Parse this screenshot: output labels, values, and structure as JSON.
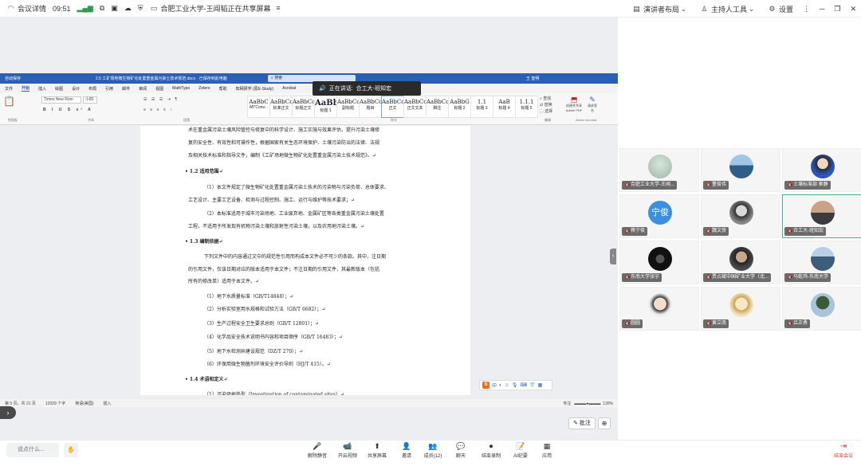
{
  "topbar": {
    "meeting_info": "会议详情",
    "time": "09:51",
    "share_title": "合肥工业大学-王闻韬正在共享屏幕",
    "presenter_layout": "演讲者布局",
    "host_tools": "主持人工具",
    "settings": "设置"
  },
  "word": {
    "autosave": "自动保存",
    "filename": "2.5 工矿场地微生物矿化处置重金属污染土技术规范.docx · 已保存到此电脑",
    "search": "搜索",
    "user": "王 奎明",
    "menus": [
      "文件",
      "开始",
      "插入",
      "绘图",
      "设计",
      "布局",
      "引用",
      "邮件",
      "审阅",
      "视图",
      "MathType",
      "Zotero",
      "帮助",
      "知网研学 (原E-Study)",
      "Acrobat"
    ],
    "font_name": "Times New Rom",
    "font_size": "小四",
    "ribbon_groups": {
      "clipboard": "剪贴板",
      "font": "字体",
      "paragraph": "段落",
      "styles": "样式",
      "edit": "编辑",
      "acrobat": "Adobe Acrobat"
    },
    "styles": [
      {
        "preview": "AaBbC",
        "name": "MTConv..."
      },
      {
        "preview": "AaBbCcDd",
        "name": "标准正文"
      },
      {
        "preview": "AaBbCcI",
        "name": "标题正文"
      },
      {
        "preview": "AaBb",
        "name": "标题 1"
      },
      {
        "preview": "AaBbCc",
        "name": "副标题"
      },
      {
        "preview": "AaBbCcDi",
        "name": "题目"
      },
      {
        "preview": "AaBbCcDi",
        "name": "正文"
      },
      {
        "preview": "AaBbCcI",
        "name": "正文文本"
      },
      {
        "preview": "AaBbCcDi",
        "name": "脚注"
      },
      {
        "preview": "AaBbG",
        "name": "标题 2"
      },
      {
        "preview": "1.1",
        "name": "标题 3"
      },
      {
        "preview": "AaB",
        "name": "标题 4"
      },
      {
        "preview": "1.1.1",
        "name": "标题 5"
      }
    ],
    "find": "查找",
    "replace": "替换",
    "select": "选择",
    "create_pdf": "创建并共享 Adobe PDF",
    "request_sign": "请求签名",
    "status": {
      "page": "第 5 页，共 21 页",
      "words": "12029 个字",
      "lang": "英语(美国)",
      "insert": "插入",
      "focus": "专注",
      "zoom": "130%"
    },
    "paragraphs": [
      "术在重金属污染土壤风险管控与修复中的科学设计、施工实施与效果评估，提升污染土壤修",
      "复的安全性、有效性和可操作性，根据国家有关生态环境保护、土壤污染防治的法律、法规",
      "及相关技术标准和指导文件，编制《工矿场地微生物矿化处置重金属污染土技术规范》。↵",
      "• 1.2  适用范围↵",
      "（1）本文件规定了微生物矿化处置重金属污染土技术的污染物与污染负荷、总体要求、",
      "工艺设计、主要工艺设备、检测与过程控制、施工、运行与维护等技术要求；↵",
      "（2）本标准适用于城市污染场地、工业废弃地、金属矿区等各类重金属污染土壤处置",
      "工程，不适用于所发现有机物污染土壤和放射性污染土壤，以及农用地污染土壤。↵",
      "• 1.3  编制依据↵",
      "下列文件中的内容通过文中的规范性引用而构成本文件必不可少的条款。其中，注日期",
      "的引用文件，仅该日期对应的版本适用于本文件；不注日期的引用文件，其最新版本（包括",
      "所有的修改单）适用于本文件。↵",
      "（1）地下水质量标准（GB/T14848）；↵",
      "（2）分析实验室用水规格和试验方法（GB/T 6682）；↵",
      "（3）生产过程安全卫生要求总则（GB/T 12801）；↵",
      "（4）化学品安全技术说明书内容和项目顺序（GB/T 16483）；↵",
      "（5）地下水检测井建设规范（DZ/T 270）；↵",
      "（6）环保用微生物菌剂环境安全评价导则（HJ/T 415）。↵",
      "• 1.4 术语和定义↵",
      "（1）污染场地热型（Investigation of contaminated sites）↵"
    ]
  },
  "speaker_banner": {
    "label": "正在讲话:",
    "name": "合工大-班知宏"
  },
  "ime_label": "中",
  "annotate": "批注",
  "participants": [
    {
      "name": "合肥工业大学-王闻...",
      "avatar": "bird",
      "color": "#9ab8a5"
    },
    {
      "name": "董俊伟",
      "avatar": "building",
      "color": "#4f7fa8"
    },
    {
      "name": "土壤标准部 崔静",
      "avatar": "woman",
      "color": "#2b56c2"
    },
    {
      "name": "蒋宁俊",
      "avatar": "text",
      "text": "宁俊",
      "color": "#3b8fe0"
    },
    {
      "name": "魏文侠",
      "avatar": "man",
      "color": "#777"
    },
    {
      "name": "合工大-班知宏",
      "avatar": "sunset",
      "color": "#c79a7a",
      "active": true
    },
    {
      "name": "东南大学张宇",
      "avatar": "cup",
      "color": "#111"
    },
    {
      "name": "贾占斌中国矿业大学（北...",
      "avatar": "man2",
      "color": "#555"
    },
    {
      "name": "马乾玮-东南大学",
      "avatar": "outdoor",
      "color": "#5a80a8"
    },
    {
      "name": "圆圆",
      "avatar": "child",
      "color": "#e8d4c0"
    },
    {
      "name": "黄立南",
      "avatar": "anime",
      "color": "#e8cf9a"
    },
    {
      "name": "吕正勇",
      "avatar": "tree",
      "color": "#6b8fb0"
    }
  ],
  "bottombar": {
    "chat_placeholder": "说点什么...",
    "buttons": [
      {
        "label": "解除静音",
        "icon": "🎤"
      },
      {
        "label": "开启视频",
        "icon": "📹"
      },
      {
        "label": "共享屏幕",
        "icon": "⬆"
      },
      {
        "label": "邀请",
        "icon": "👤"
      },
      {
        "label": "成员(12)",
        "icon": "👥"
      },
      {
        "label": "聊天",
        "icon": "💬"
      },
      {
        "label": "结束录制",
        "icon": "⏺"
      },
      {
        "label": "AI纪要",
        "icon": "📝"
      },
      {
        "label": "应用",
        "icon": "▦"
      }
    ],
    "leave": "结束会议"
  }
}
